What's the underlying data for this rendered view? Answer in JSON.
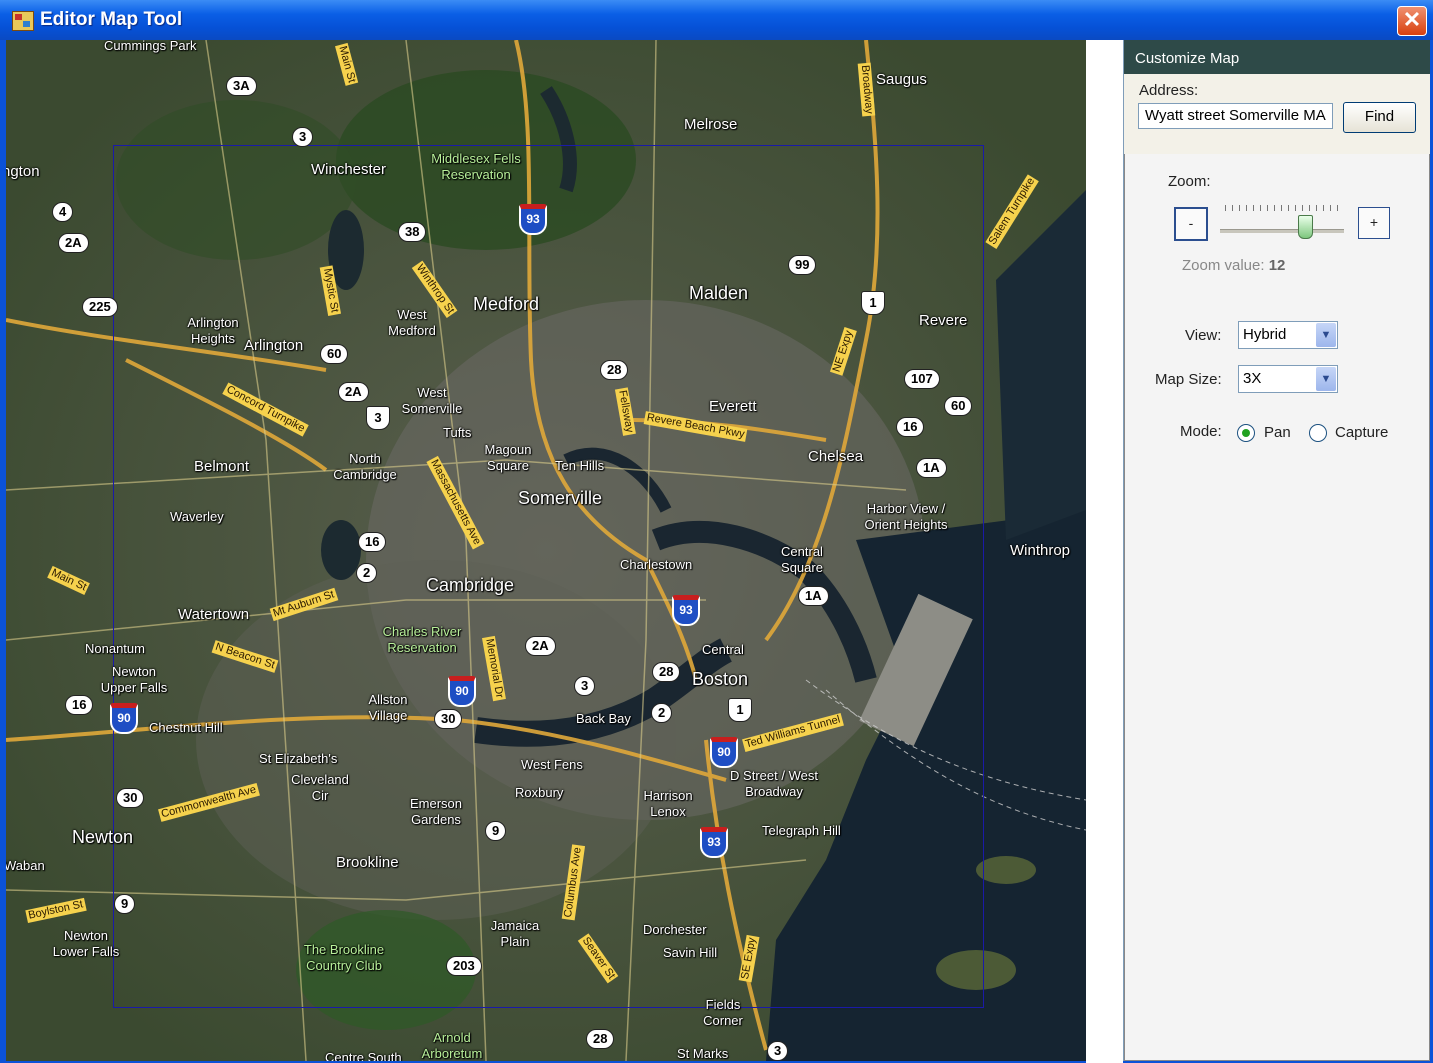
{
  "window": {
    "title": "Editor Map Tool",
    "close_label": "✕"
  },
  "panel": {
    "header": "Customize Map",
    "address_label": "Address:",
    "address_value": "Wyatt street Somerville MA",
    "find_label": "Find",
    "zoom_label": "Zoom:",
    "zoom_minus": "-",
    "zoom_plus": "+",
    "zoom_value_label": "Zoom value:",
    "zoom_value": "12",
    "view_label": "View:",
    "view_value": "Hybrid",
    "map_size_label": "Map Size:",
    "map_size_value": "3X",
    "mode_label": "Mode:",
    "mode_pan": "Pan",
    "mode_capture": "Capture",
    "dropdown_arrow": "▼"
  },
  "map": {
    "places": [
      "Cummings Park",
      "Saugus",
      "Melrose",
      "Winchester",
      "Medford",
      "Malden",
      "Revere",
      "Arlington",
      "Belmont",
      "Everett",
      "Chelsea",
      "Somerville",
      "Cambridge",
      "Charlestown",
      "Waverley",
      "Watertown",
      "Nonantum",
      "Boston",
      "Back Bay",
      "Chestnut Hill",
      "Newton",
      "Brookline",
      "Roxbury",
      "West Fens",
      "Dorchester",
      "Savin Hill",
      "Winthrop",
      "Jamaica Plain",
      "Fields Corner",
      "St Marks",
      "Centre South",
      "Telegraph Hill",
      "Tufts",
      "Ten Hills",
      "Central Square",
      "Central",
      "Harrison Lenox",
      "Emerson Gardens",
      "St Elizabeth's",
      "Cleveland Cir",
      "Allston Village",
      "Magoun Square",
      "North Cambridge",
      "West Somerville",
      "West Medford",
      "Arlington Heights",
      "Harbor View / Orient Heights",
      "D Street / West Broadway",
      "Newton Upper Falls",
      "Newton Lower Falls",
      "Waban",
      "ngton"
    ],
    "parks": [
      "Middlesex Fells Reservation",
      "Charles River Reservation",
      "The Brookline Country Club",
      "Arnold Arboretum"
    ],
    "roads": [
      "Main St",
      "Broadway",
      "Mystic St",
      "Winthrop St",
      "Concord Turnpike",
      "Massachusetts Ave",
      "Fellsway",
      "Revere Beach Pkwy",
      "NE Expy",
      "Salem Turnpike",
      "Memorial Dr",
      "Mt Auburn St",
      "N Beacon St",
      "Main St",
      "Commonwealth Ave",
      "Boylston St",
      "Columbus Ave",
      "Seaver St",
      "SE Expy",
      "Ted Williams Tunnel"
    ],
    "shields": [
      "3A",
      "3",
      "4",
      "2A",
      "225",
      "38",
      "99",
      "1",
      "60",
      "28",
      "107",
      "2A",
      "3",
      "60",
      "16",
      "1A",
      "16",
      "2",
      "2A",
      "3",
      "28",
      "2",
      "1A",
      "30",
      "16",
      "30",
      "9",
      "9",
      "203",
      "28",
      "3",
      "1"
    ],
    "interstates": [
      "93",
      "93",
      "90",
      "90",
      "90",
      "93"
    ]
  }
}
